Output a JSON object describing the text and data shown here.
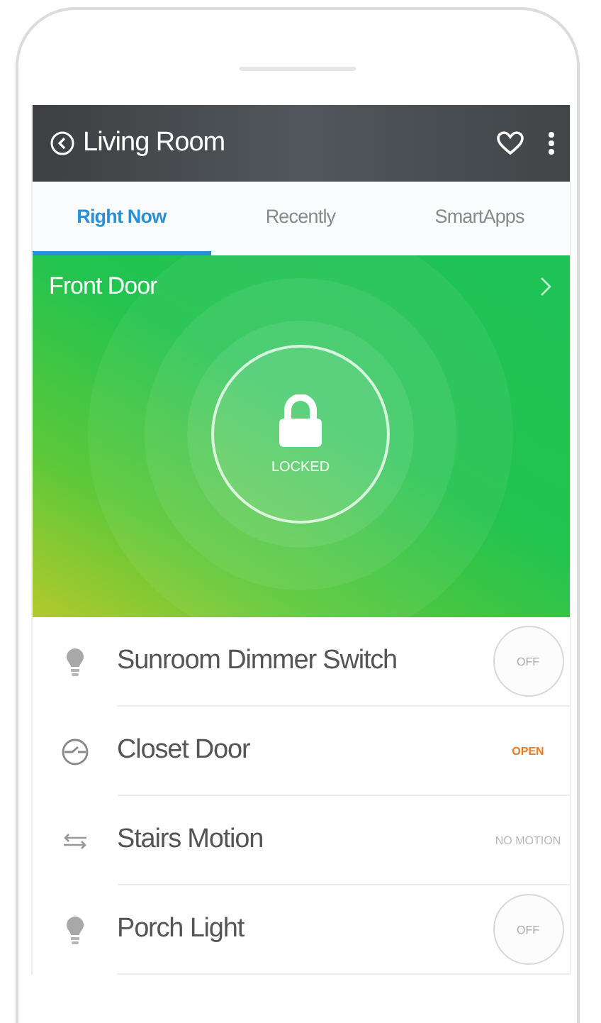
{
  "header": {
    "title": "Living Room"
  },
  "tabs": [
    {
      "label": "Right Now",
      "selected": true
    },
    {
      "label": "Recently",
      "selected": false
    },
    {
      "label": "SmartApps",
      "selected": false
    }
  ],
  "hero": {
    "title": "Front Door",
    "status": "LOCKED",
    "locked": true
  },
  "devices": [
    {
      "kind": "switch",
      "name": "Sunroom Dimmer Switch",
      "status": "OFF"
    },
    {
      "kind": "contact",
      "name": "Closet Door",
      "status": "OPEN"
    },
    {
      "kind": "motion",
      "name": "Stairs Motion",
      "status": "NO MOTION"
    },
    {
      "kind": "switch",
      "name": "Porch Light",
      "status": "OFF"
    }
  ]
}
